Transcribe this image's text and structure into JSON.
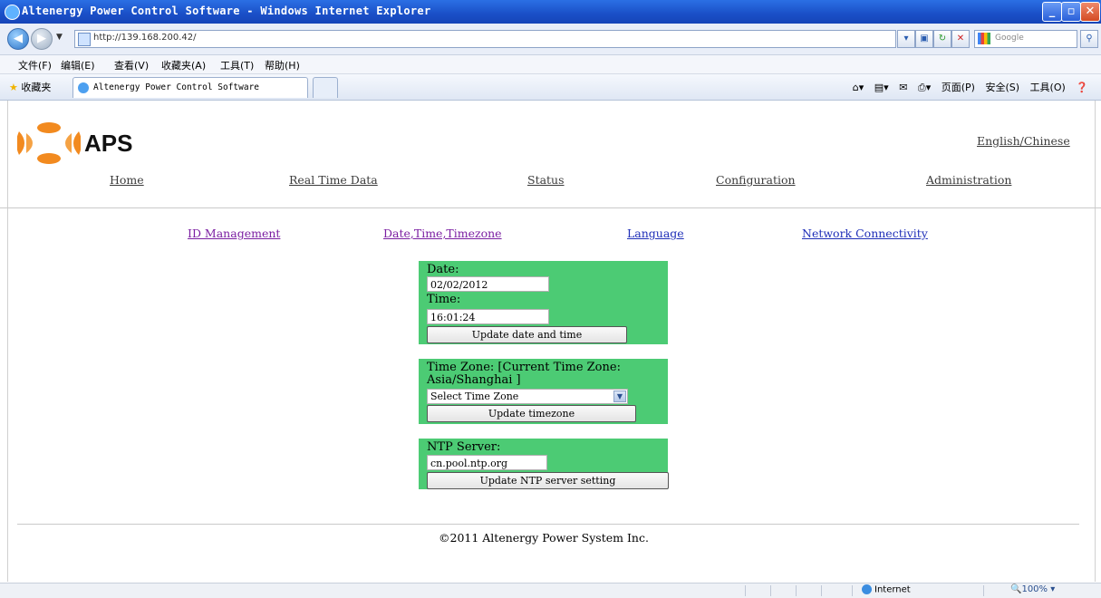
{
  "window": {
    "title": "Altenergy Power Control Software - Windows Internet Explorer",
    "controls": {
      "minimize": "_",
      "maximize": "▫",
      "close": "✕"
    }
  },
  "browser": {
    "url": "http://139.168.200.42/",
    "search_placeholder": "Google",
    "menu": [
      "文件(F)",
      "编辑(E)",
      "查看(V)",
      "收藏夹(A)",
      "工具(T)",
      "帮助(H)"
    ],
    "favorites_label": "收藏夹",
    "tab_title": "Altenergy Power Control Software",
    "command_bar": [
      "页面(P)",
      "安全(S)",
      "工具(O)"
    ],
    "status_zone": "Internet",
    "zoom": "100%"
  },
  "page": {
    "logo_text": "APS",
    "language_link": "English/Chinese",
    "nav": [
      "Home",
      "Real Time Data",
      "Status",
      "Configuration",
      "Administration"
    ],
    "subnav": [
      "ID Management",
      "Date,Time,Timezone",
      "Language",
      "Network Connectivity"
    ],
    "datetime": {
      "date_label": "Date:",
      "date_value": "02/02/2012",
      "time_label": "Time:",
      "time_value": "16:01:24",
      "update_button": "Update date and time"
    },
    "timezone": {
      "label_line1": "Time Zone: [Current Time Zone:",
      "label_line2": "Asia/Shanghai ]",
      "select_value": "Select Time Zone",
      "update_button": "Update timezone"
    },
    "ntp": {
      "label": "NTP Server:",
      "value": "cn.pool.ntp.org",
      "update_button": "Update NTP server setting"
    },
    "footer": "©2011 Altenergy Power System Inc."
  },
  "colors": {
    "form_background": "#4ccb74",
    "logo_orange": "#f28a1f",
    "titlebar_blue": "#1a4fc7"
  }
}
